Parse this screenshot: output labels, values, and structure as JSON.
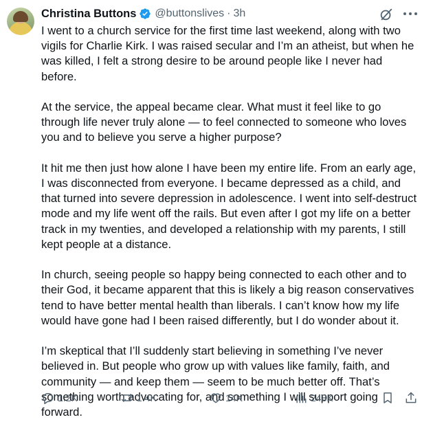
{
  "author": {
    "name": "Christina Buttons",
    "handle": "@buttonslives",
    "separator": "·",
    "time": "3h"
  },
  "post": {
    "paragraphs": [
      "I went to a church service for the first time last weekend, along with two vigils for Charlie Kirk. I was raised secular and I’m an atheist, but when he was killed, I felt a strong desire to be around people like I never had before.",
      "At the service, the appeal became clear. What must it feel like to go through life never truly alone — to feel connected to someone who loves you and to believe you serve a higher purpose?",
      "It hit me then just how alone I have been my entire life. From an early age, I was disconnected from everyone. I became depressed as a child, and that turned into severe depression in adolescence. I went into self-destruct mode and my life went off the rails. But even after I got my life on a better track in my twenties, and developed a relationship with my parents, I still kept people at a distance.",
      "In church, seeing people so happy being connected to each other and to their God, it became apparent that this is likely a big reason conservatives tend to have better mental health than liberals. I can’t know how my life would have gone had I been raised differently, but I do wonder about it.",
      "I’m skeptical that I’ll suddenly start believing in something I’ve never believed in. But people who grow up with values like family, faith, and community — and keep them — seem to be much better off. That’s something worth advocating for, and something I will support going forward."
    ]
  },
  "metrics": {
    "replies": "1.2K",
    "reposts": "1.4K",
    "likes": "14K",
    "views": "248K"
  },
  "colors": {
    "text": "#0f1419",
    "secondary": "#536471",
    "verified": "#1d9bf0"
  },
  "icons": [
    "verified-badge-icon",
    "grok-icon",
    "more-icon",
    "reply-icon",
    "repost-icon",
    "like-icon",
    "views-icon",
    "bookmark-icon",
    "share-icon"
  ]
}
